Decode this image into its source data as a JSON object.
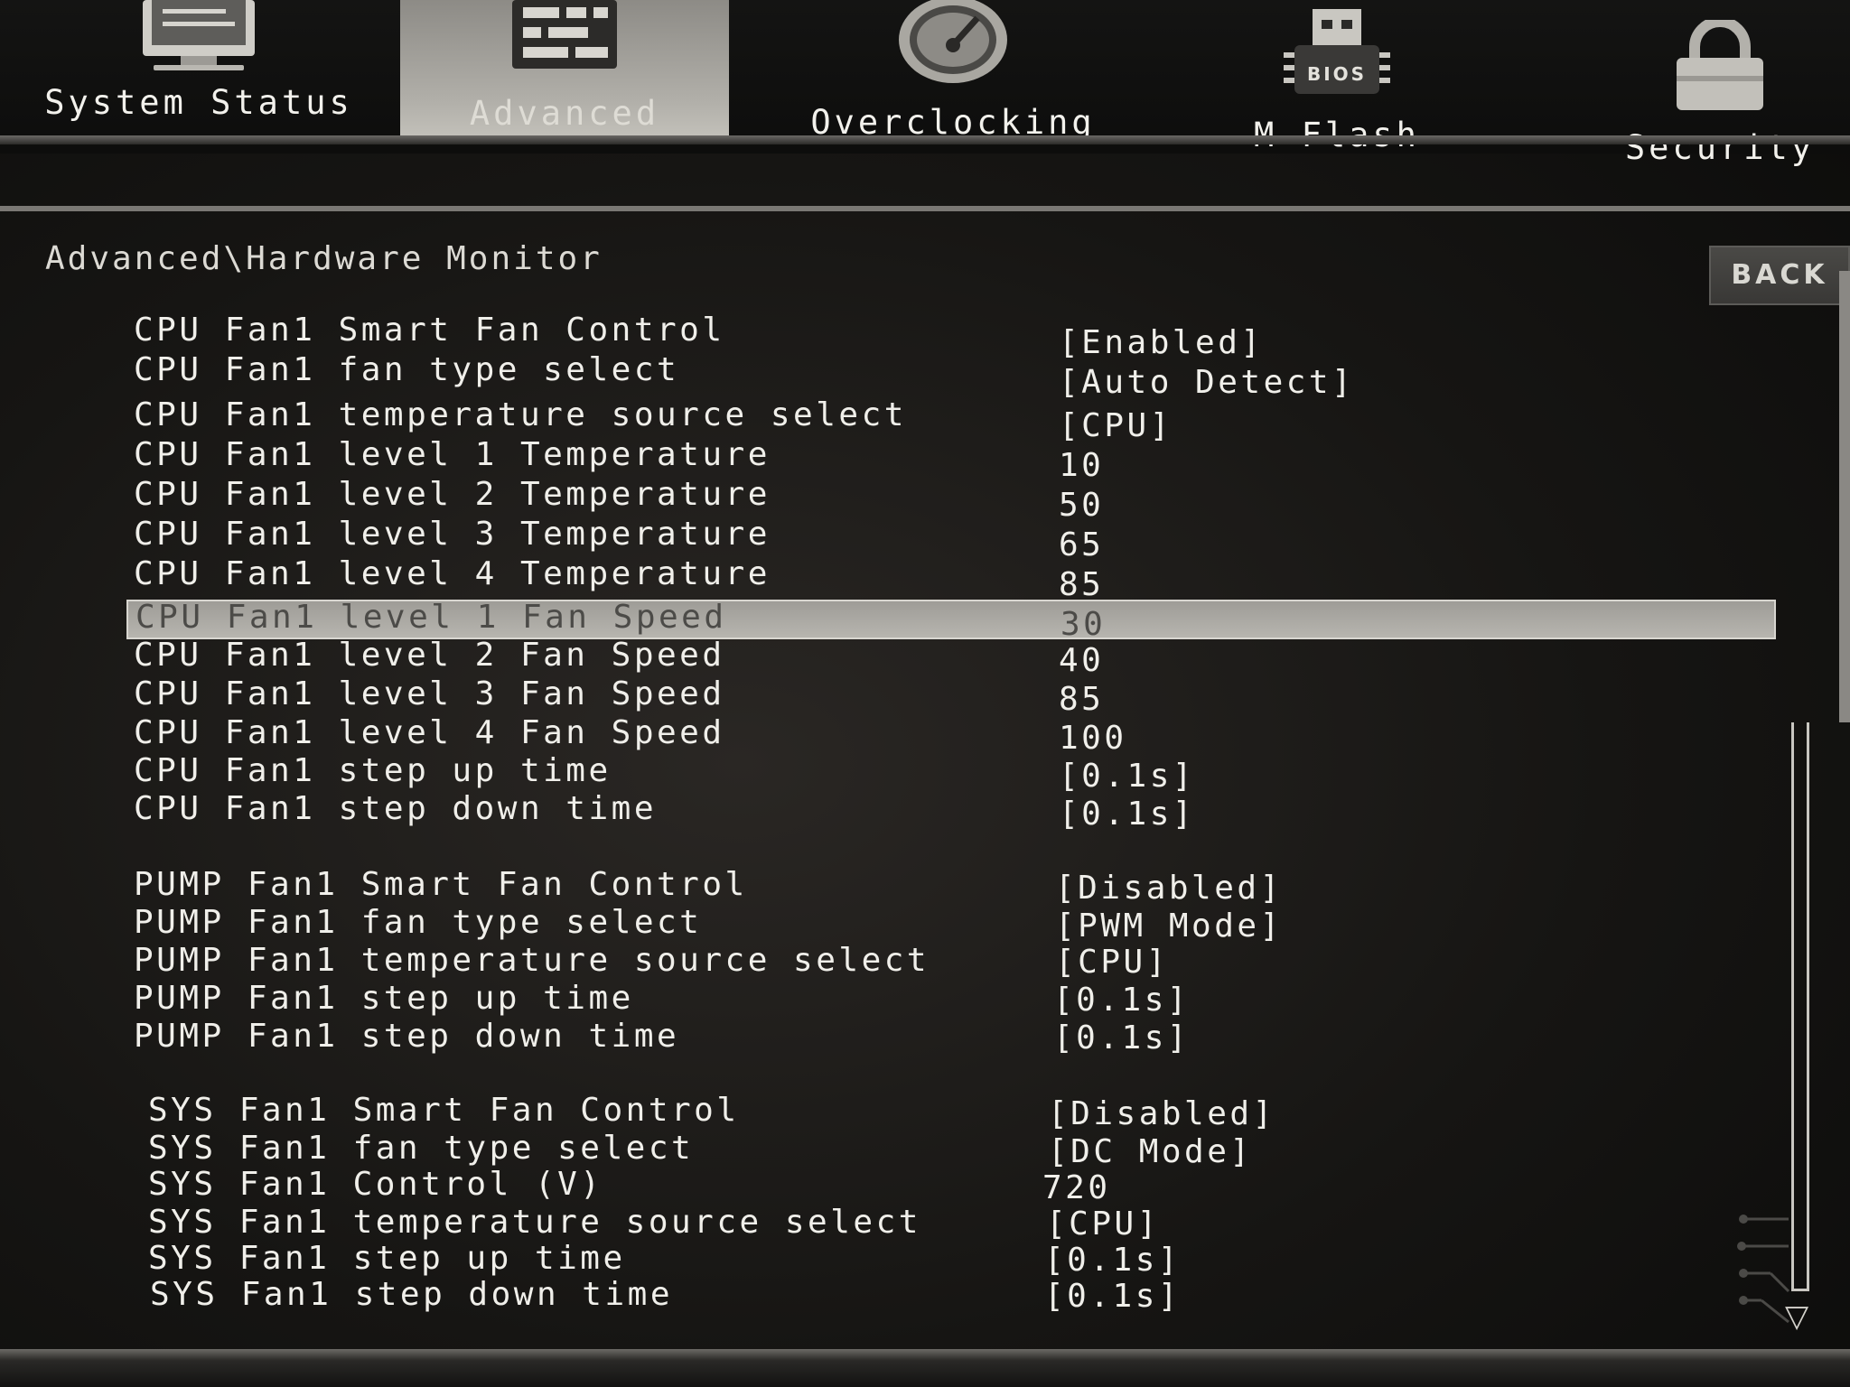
{
  "nav": {
    "tabs": [
      {
        "label": "System Status",
        "icon": "monitor-icon",
        "active": false
      },
      {
        "label": "Advanced",
        "icon": "settings-panel-icon",
        "active": true
      },
      {
        "label": "Overclocking",
        "icon": "gauge-icon",
        "active": false
      },
      {
        "label": "M-Flash",
        "icon": "usb-bios-icon",
        "active": false,
        "icon_text": "BIOS"
      },
      {
        "label": "Security",
        "icon": "lock-icon",
        "active": false
      }
    ]
  },
  "breadcrumb": "Advanced\\Hardware Monitor",
  "back_label": "BACK",
  "settings": [
    {
      "label": "CPU Fan1 Smart Fan Control",
      "value": "[Enabled]"
    },
    {
      "label": "CPU Fan1 fan type select",
      "value": "[Auto Detect]"
    },
    {
      "label": "CPU Fan1 temperature source select",
      "value": "[CPU]"
    },
    {
      "label": "CPU Fan1 level 1 Temperature",
      "value": "10"
    },
    {
      "label": "CPU Fan1 level 2 Temperature",
      "value": "50"
    },
    {
      "label": "CPU Fan1 level 3 Temperature",
      "value": "65"
    },
    {
      "label": "CPU Fan1 level 4 Temperature",
      "value": "85"
    },
    {
      "label": "CPU Fan1 level 1 Fan Speed",
      "value": "30",
      "selected": true
    },
    {
      "label": "CPU Fan1 level 2 Fan Speed",
      "value": "40"
    },
    {
      "label": "CPU Fan1 level 3 Fan Speed",
      "value": "85"
    },
    {
      "label": "CPU Fan1 level 4 Fan Speed",
      "value": "100"
    },
    {
      "label": "CPU Fan1 step up time",
      "value": "[0.1s]"
    },
    {
      "label": "CPU Fan1 step down time",
      "value": "[0.1s]"
    },
    {
      "label": "PUMP Fan1 Smart Fan Control",
      "value": "[Disabled]"
    },
    {
      "label": "PUMP Fan1 fan type select",
      "value": "[PWM Mode]"
    },
    {
      "label": "PUMP Fan1 temperature source select",
      "value": "[CPU]"
    },
    {
      "label": "PUMP Fan1 step up time",
      "value": "[0.1s]"
    },
    {
      "label": "PUMP Fan1 step down time",
      "value": "[0.1s]"
    },
    {
      "label": "SYS Fan1 Smart Fan Control",
      "value": "[Disabled]"
    },
    {
      "label": "SYS Fan1 fan type select",
      "value": "[DC Mode]"
    },
    {
      "label": "SYS Fan1 Control (V)",
      "value": "720"
    },
    {
      "label": "SYS Fan1 temperature source select",
      "value": "[CPU]"
    },
    {
      "label": "SYS Fan1 step up time",
      "value": "[0.1s]"
    },
    {
      "label": "SYS Fan1 step down time",
      "value": "[0.1s]"
    }
  ]
}
